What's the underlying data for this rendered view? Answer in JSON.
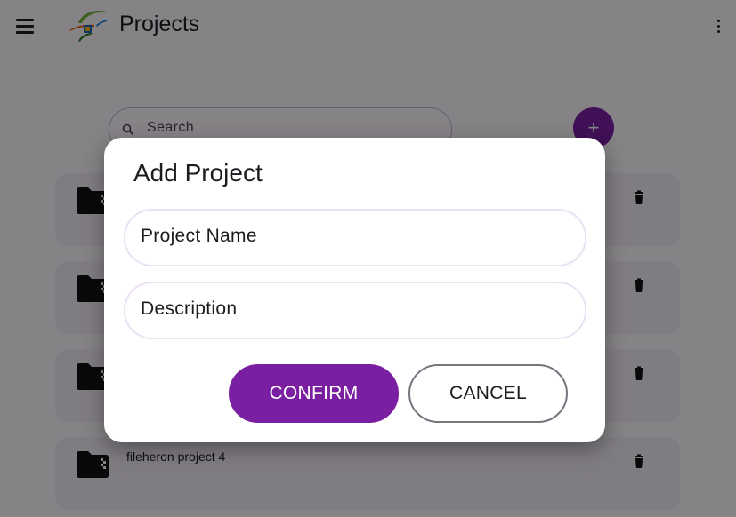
{
  "app_bar": {
    "title": "Projects",
    "menu_icon": "hamburger-menu-icon",
    "overflow_icon": "more-vert-icon",
    "logo": "fileheron-logo"
  },
  "search": {
    "placeholder": "Search",
    "icon": "search-icon"
  },
  "fab": {
    "label": "+",
    "icon": "add-icon"
  },
  "projects": [
    {
      "name": ""
    },
    {
      "name": ""
    },
    {
      "name": ""
    },
    {
      "name": "fileheron project 4"
    }
  ],
  "dialog": {
    "title": "Add Project",
    "name_placeholder": "Project Name",
    "description_placeholder": "Description",
    "confirm_label": "CONFIRM",
    "cancel_label": "CANCEL"
  },
  "colors": {
    "primary": "#7b1fa2",
    "surface": "#fbf8fc",
    "card": "#f2ecf6",
    "field_border": "#ebe1f3",
    "scrim": "rgba(0,0,0,0.47)"
  }
}
